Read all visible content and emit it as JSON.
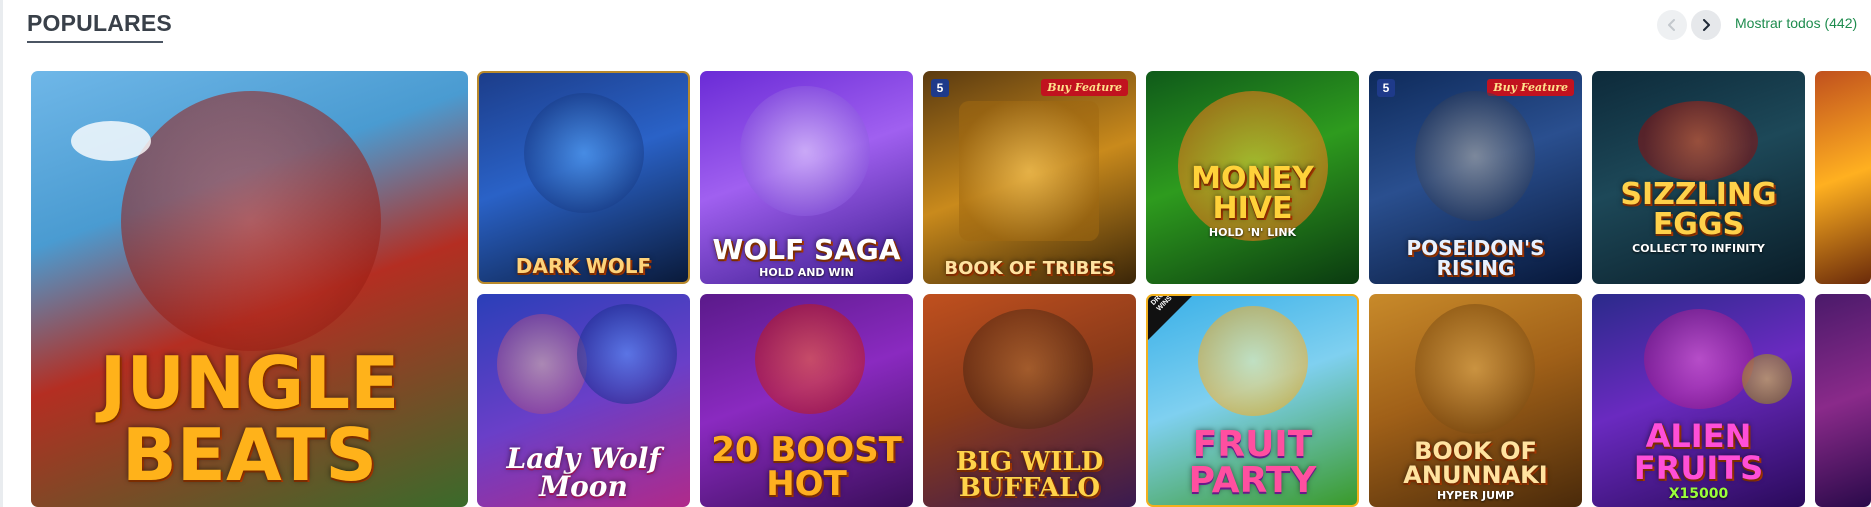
{
  "section": {
    "title": "POPULARES",
    "show_all": "Mostrar todos (442)"
  },
  "nav": {
    "prev_icon": "chevron-left-icon",
    "next_icon": "chevron-right-icon"
  },
  "games": [
    {
      "id": "jungle-beats",
      "title": "JUNGLE BEATS",
      "sub": "",
      "bg": "linear-gradient(160deg,#6fb7e8 0%,#4a9bd1 30%,#b42e22 55%,#3a6b2b 100%)",
      "color": "#ffb21a"
    },
    {
      "id": "dark-wolf",
      "title": "DARK WOLF",
      "sub": "",
      "bg": "linear-gradient(160deg,#1c3d8a 0%,#2a62c7 45%,#0a1a3a 100%)",
      "color": "#ffd37a"
    },
    {
      "id": "wolf-saga",
      "title": "WOLF SAGA",
      "sub": "HOLD AND WIN",
      "bg": "linear-gradient(160deg,#6a2bd6 0%,#a060f0 45%,#3a1a8a 100%)",
      "color": "#ffffff"
    },
    {
      "id": "book-of-tribes",
      "title": "BOOK OF TRIBES",
      "sub": "",
      "bg": "linear-gradient(160deg,#5a3a10 0%,#c98a1c 50%,#3a2508 100%)",
      "color": "#ffe3a0"
    },
    {
      "id": "money-hive",
      "title": "MONEY HIVE",
      "sub": "HOLD 'N' LINK",
      "bg": "linear-gradient(160deg,#0f5a1a 0%,#2e9b1e 45%,#0a3a10 100%)",
      "color": "#ffd23a"
    },
    {
      "id": "poseidons-rising",
      "title": "POSEIDON'S RISING",
      "sub": "",
      "bg": "linear-gradient(160deg,#0e2a5a 0%,#2a4f8f 45%,#07183a 100%)",
      "color": "#e8f1ff"
    },
    {
      "id": "sizzling-eggs",
      "title": "SIZZLING EGGS",
      "sub": "COLLECT TO INFINITY",
      "bg": "linear-gradient(160deg,#0d2a3a 0%,#1d4858 45%,#0a1d28 100%)",
      "color": "#ffd14a"
    },
    {
      "id": "lady-wolf-moon",
      "title": "Lady Wolf Moon",
      "sub": "",
      "bg": "linear-gradient(160deg,#2a3fb8 0%,#6a3fc8 50%,#b02a8a 100%)",
      "color": "#ffffff"
    },
    {
      "id": "20-boost-hot",
      "title": "20 BOOST HOT",
      "sub": "",
      "bg": "linear-gradient(160deg,#5a1a8a 0%,#8a2ac0 45%,#3a0e5a 100%)",
      "color": "#ffb020"
    },
    {
      "id": "big-wild-buffalo",
      "title": "BIG WILD BUFFALO",
      "sub": "",
      "bg": "linear-gradient(160deg,#c0501e 0%,#8a3a1a 45%,#3a1a50 100%)",
      "color": "#ffd34a"
    },
    {
      "id": "fruit-party",
      "title": "FRUIT PARTY",
      "sub": "",
      "bg": "linear-gradient(160deg,#3ab0e8 0%,#7fd0f0 45%,#3a9a2a 100%)",
      "color": "#ff4fa0"
    },
    {
      "id": "book-of-anunnaki",
      "title": "BOOK OF ANUNNAKI",
      "sub": "HYPER JUMP",
      "bg": "linear-gradient(160deg,#c88a2a 0%,#a06018 45%,#4a2a0a 100%)",
      "color": "#ffe3a0"
    },
    {
      "id": "alien-fruits",
      "title": "ALIEN FRUITS",
      "sub": "X15000",
      "bg": "linear-gradient(160deg,#2a2a8a 0%,#6a2ac0 45%,#2a0a5a 100%)",
      "color": "#ff4fd8"
    }
  ],
  "badges": {
    "buy_feature": "Buy Feature",
    "five": "5",
    "drops_wins": "DROPS & WINS"
  }
}
